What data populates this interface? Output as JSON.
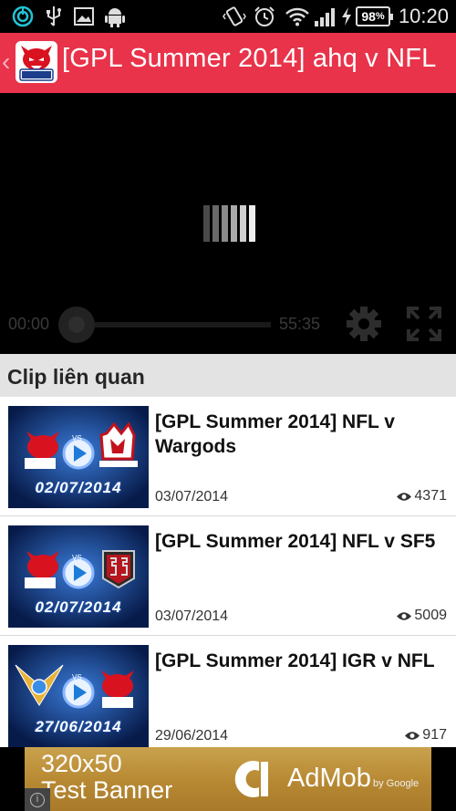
{
  "status_bar": {
    "time": "10:20",
    "battery": "98",
    "icons": [
      "power-icon",
      "usb-icon",
      "image-icon",
      "android-icon",
      "vibrate-icon",
      "alarm-icon",
      "wifi-icon",
      "signal-icon",
      "charging-icon"
    ]
  },
  "action_bar": {
    "title": "[GPL Summer 2014] ahq v NFL",
    "logo_icon": "full-louis-logo"
  },
  "player": {
    "current_time": "00:00",
    "total_time": "55:35",
    "progress": 0,
    "icons": [
      "loading-spinner-icon",
      "settings-gear-icon",
      "fullscreen-icon"
    ]
  },
  "related": {
    "heading": "Clip liên quan",
    "clips": [
      {
        "title": "[GPL Summer 2014] NFL v Wargods",
        "date": "03/07/2014",
        "views": "4371",
        "thumb_date": "02/07/2014",
        "opponent": "wargods-logo"
      },
      {
        "title": "[GPL Summer 2014] NFL v SF5",
        "date": "03/07/2014",
        "views": "5009",
        "thumb_date": "02/07/2014",
        "opponent": "sf5-logo"
      },
      {
        "title": "[GPL Summer 2014] IGR v NFL",
        "date": "29/06/2014",
        "views": "917",
        "thumb_date": "27/06/2014",
        "opponent": "igr-logo"
      }
    ]
  },
  "ad": {
    "line1": "320x50",
    "line2": "Test Banner",
    "brand": "AdMob",
    "brand_sub": "by Google",
    "icon": "info-icon"
  },
  "colors": {
    "action_bar": "#e8334a",
    "spinner": "#9a9a9a"
  }
}
